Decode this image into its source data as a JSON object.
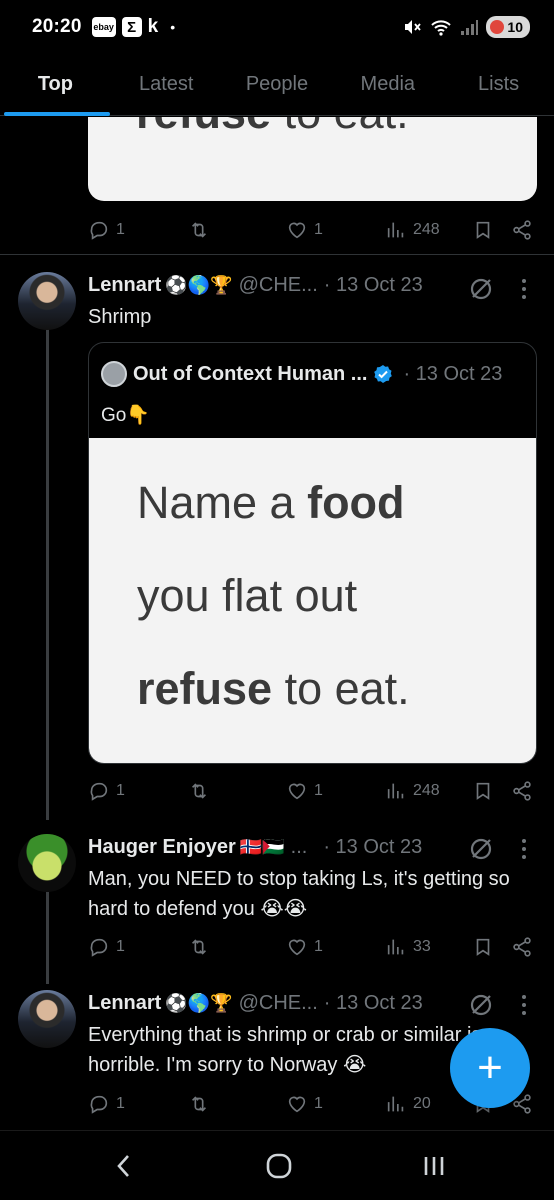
{
  "status_bar": {
    "time": "20:20",
    "app_icons": [
      "ebay-icon",
      "sigma-icon",
      "k-icon"
    ],
    "battery": "10"
  },
  "tabs": [
    {
      "label": "Top",
      "active": true
    },
    {
      "label": "Latest",
      "active": false
    },
    {
      "label": "People",
      "active": false
    },
    {
      "label": "Media",
      "active": false
    },
    {
      "label": "Lists",
      "active": false
    }
  ],
  "top_card": {
    "image_text_partial": {
      "bold": "refuse",
      "rest": " to eat."
    },
    "actions": {
      "replies": "1",
      "reposts": "",
      "likes": "1",
      "views": "248"
    }
  },
  "tweet1": {
    "name": "Lennart",
    "emojis": "⚽🌎🏆",
    "handle": "@CHE...",
    "time": "· 13 Oct 23",
    "text": "Shrimp",
    "quote": {
      "name": "Out of Context Human ...",
      "time": "· 13 Oct 23",
      "text": "Go👇",
      "image_lines": [
        {
          "plain": "Name a ",
          "bold": "food"
        },
        {
          "plain": "you flat out",
          "bold": ""
        },
        {
          "bold": "refuse",
          "plain": " to eat."
        }
      ]
    },
    "actions": {
      "replies": "1",
      "likes": "1",
      "views": "248"
    }
  },
  "tweet2": {
    "name": "Hauger Enjoyer",
    "emojis": "🇳🇴🇵🇸",
    "handle": "...",
    "time": "· 13 Oct 23",
    "text": "Man, you NEED to stop taking Ls, it's getting so hard to defend you 😭😭",
    "actions": {
      "replies": "1",
      "likes": "1",
      "views": "33"
    }
  },
  "tweet3": {
    "name": "Lennart",
    "emojis": "⚽🌎🏆",
    "handle": "@CHE...",
    "time": "· 13 Oct 23",
    "text": "Everything that is shrimp or crab or similar is horrible. I'm sorry to Norway 😭",
    "actions": {
      "replies": "1",
      "likes": "1",
      "views": "20"
    }
  },
  "fab": {
    "label": "+"
  },
  "colors": {
    "accent": "#1d9bf0",
    "background": "#000000",
    "muted": "#71767b"
  }
}
